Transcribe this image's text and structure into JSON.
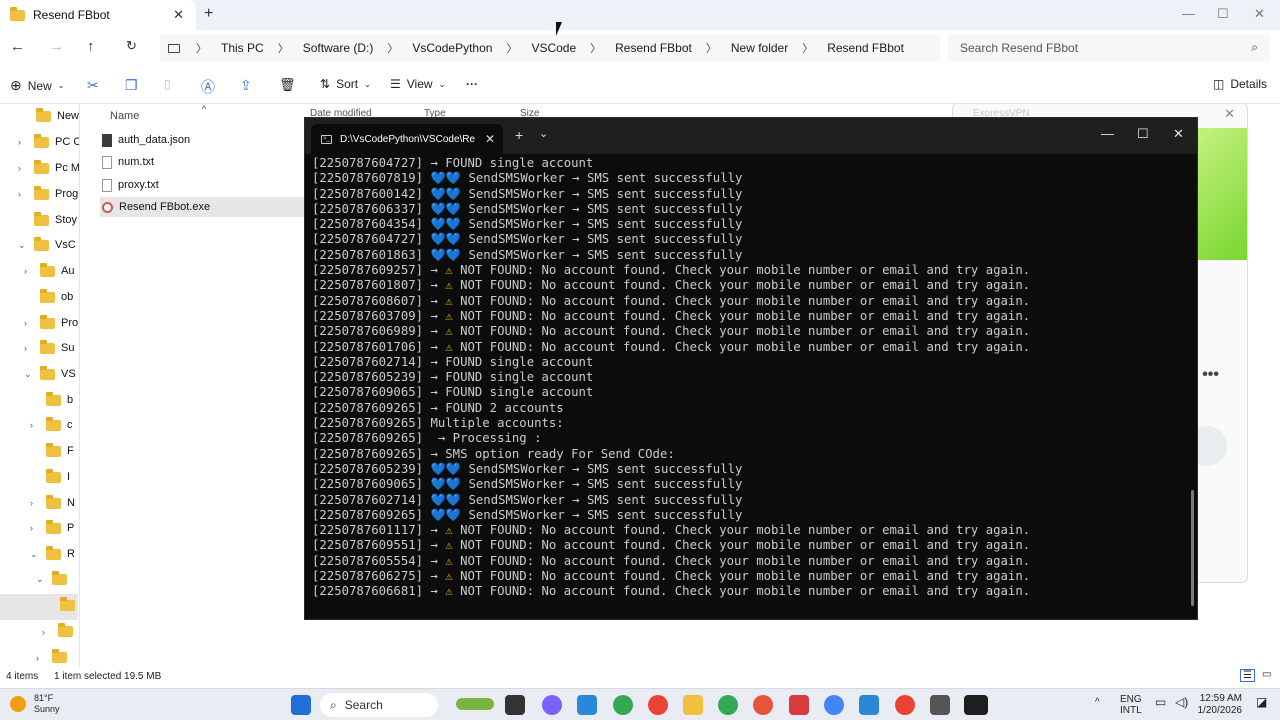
{
  "explorer": {
    "tab_title": "Resend FBbot",
    "breadcrumbs": [
      "This PC",
      "Software (D:)",
      "VsCodePython",
      "VSCode",
      "Resend FBbot",
      "New folder",
      "Resend FBbot"
    ],
    "search_placeholder": "Search Resend FBbot",
    "toolbar": {
      "new": "New",
      "sort": "Sort",
      "view": "View",
      "more": "···",
      "details": "Details"
    },
    "columns": {
      "name": "Name",
      "date": "Date modified",
      "type": "Type",
      "size": "Size"
    },
    "sidebar": [
      "New",
      "PC C",
      "Pc M",
      "Prog",
      "Stoy",
      "VsC",
      "Au",
      "ob",
      "Pro",
      "Su",
      "VS",
      "b",
      "c",
      "F",
      "I",
      "N",
      "P",
      "R"
    ],
    "files": [
      {
        "name": "auth_data.json",
        "icon": "json-file-icon"
      },
      {
        "name": "num.txt",
        "icon": "text-file-icon"
      },
      {
        "name": "proxy.txt",
        "icon": "text-file-icon"
      },
      {
        "name": "Resend FBbot.exe",
        "icon": "exe-file-icon",
        "selected": true
      }
    ],
    "status": {
      "items": "4 items",
      "selected": "1 item selected  19.5 MB"
    }
  },
  "vpn": {
    "title": "ExpressVPN"
  },
  "terminal": {
    "tab_title": "D:\\VsCodePython\\VSCode\\Re",
    "lines": [
      "[2250787604727] → FOUND single account",
      "[2250787607819] 💙💙 SendSMSWorker → SMS sent successfully",
      "[2250787600142] 💙💙 SendSMSWorker → SMS sent successfully",
      "[2250787606337] 💙💙 SendSMSWorker → SMS sent successfully",
      "[2250787604354] 💙💙 SendSMSWorker → SMS sent successfully",
      "[2250787604727] 💙💙 SendSMSWorker → SMS sent successfully",
      "[2250787601863] 💙💙 SendSMSWorker → SMS sent successfully",
      "[2250787609257] → ⚠ NOT FOUND: No account found. Check your mobile number or email and try again.",
      "[2250787601807] → ⚠ NOT FOUND: No account found. Check your mobile number or email and try again.",
      "[2250787608607] → ⚠ NOT FOUND: No account found. Check your mobile number or email and try again.",
      "[2250787603709] → ⚠ NOT FOUND: No account found. Check your mobile number or email and try again.",
      "[2250787606989] → ⚠ NOT FOUND: No account found. Check your mobile number or email and try again.",
      "[2250787601706] → ⚠ NOT FOUND: No account found. Check your mobile number or email and try again.",
      "[2250787602714] → FOUND single account",
      "[2250787605239] → FOUND single account",
      "[2250787609065] → FOUND single account",
      "[2250787609265] → FOUND 2 accounts",
      "[2250787609265] Multiple accounts:",
      "[2250787609265]  → Processing :",
      "[2250787609265] → SMS option ready For Send COde:",
      "[2250787605239] 💙💙 SendSMSWorker → SMS sent successfully",
      "[2250787609065] 💙💙 SendSMSWorker → SMS sent successfully",
      "[2250787602714] 💙💙 SendSMSWorker → SMS sent successfully",
      "[2250787609265] 💙💙 SendSMSWorker → SMS sent successfully",
      "[2250787601117] → ⚠ NOT FOUND: No account found. Check your mobile number or email and try again.",
      "[2250787609551] → ⚠ NOT FOUND: No account found. Check your mobile number or email and try again.",
      "[2250787605554] → ⚠ NOT FOUND: No account found. Check your mobile number or email and try again.",
      "[2250787606275] → ⚠ NOT FOUND: No account found. Check your mobile number or email and try again.",
      "[2250787606681] → ⚠ NOT FOUND: No account found. Check your mobile number or email and try again."
    ]
  },
  "taskbar": {
    "weather": {
      "temp": "81°F",
      "cond": "Sunny"
    },
    "search": "Search",
    "lang": {
      "line1": "ENG",
      "line2": "INTL"
    },
    "time": "12:59 AM",
    "date": "1/20/2026"
  }
}
